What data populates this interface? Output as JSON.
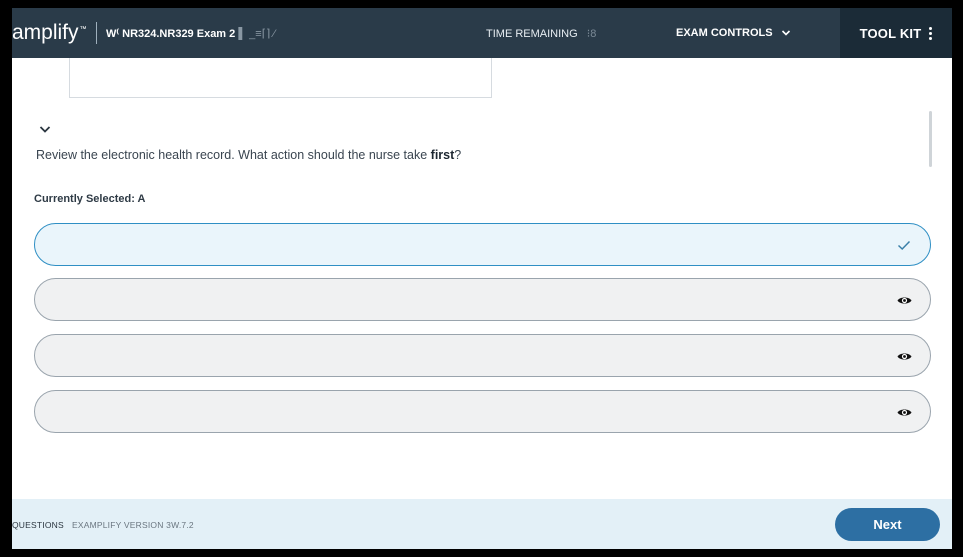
{
  "brand": {
    "name": "amplify",
    "mark": "™"
  },
  "header": {
    "exam_title": "W⁽ NR324.NR329 Exam 2",
    "exam_title_obscured": "▌ _≡⌈⌉ ⁄",
    "time_remaining_label": "TIME REMAINING",
    "time_remaining_value": "⁝8",
    "exam_controls_label": "EXAM CONTROLS",
    "toolkit_label": "TOOL KIT"
  },
  "question": {
    "text_before": "Review the electronic health record. What action should the nurse take ",
    "text_bold": "first",
    "text_after": "?",
    "selected_label": "Currently Selected: A"
  },
  "options": [
    {
      "id": "A",
      "text": "",
      "selected": true
    },
    {
      "id": "B",
      "text": "",
      "selected": false
    },
    {
      "id": "C",
      "text": "",
      "selected": false
    },
    {
      "id": "D",
      "text": "",
      "selected": false
    }
  ],
  "footer": {
    "questions_label": "QUESTIONS",
    "version_label": "EXAMPLIFY VERSION 3W.7.2",
    "next_label": "Next"
  },
  "colors": {
    "header_bg": "#2a3b49",
    "toolkit_bg": "#1b2b37",
    "selected_border": "#2f8fc4",
    "next_button": "#2d6fa3",
    "footer_bg": "#e3f0f7"
  },
  "icons": {
    "collapse": "chevron-down-icon",
    "selected_marker": "check-icon",
    "option_marker": "eye-icon",
    "toolkit": "kebab-menu-icon"
  }
}
